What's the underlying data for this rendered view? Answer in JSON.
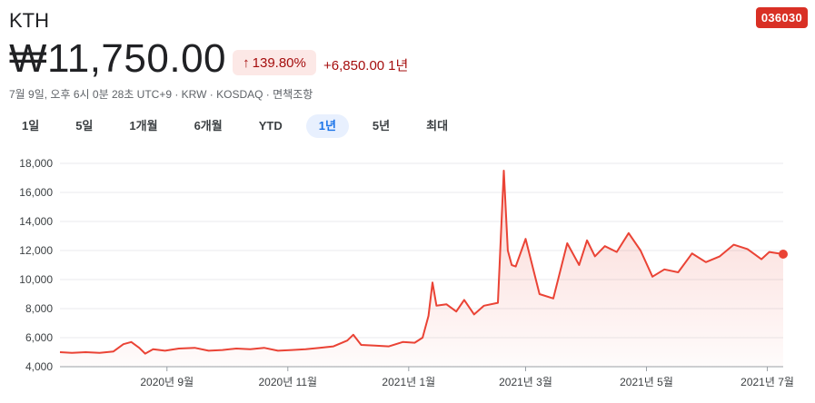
{
  "header": {
    "name": "KTH",
    "ticker": "036030",
    "price": "₩11,750.00",
    "change_pct": "139.80%",
    "change_abs": "+6,850.00",
    "period": "1년",
    "meta": "7월 9일, 오후 6시 0분 28초 UTC+9 · KRW · KOSDAQ · 면책조항"
  },
  "tabs": [
    {
      "label": "1일"
    },
    {
      "label": "5일"
    },
    {
      "label": "1개월"
    },
    {
      "label": "6개월"
    },
    {
      "label": "YTD"
    },
    {
      "label": "1년",
      "active": true
    },
    {
      "label": "5년"
    },
    {
      "label": "최대"
    }
  ],
  "colors": {
    "line": "#ea4335",
    "badge": "#d93025",
    "positive_text": "#a50e0e",
    "active_tab": "#1a73e8"
  },
  "chart_data": {
    "type": "area",
    "ylim": [
      4000,
      18000
    ],
    "y_ticks": [
      4000,
      6000,
      8000,
      10000,
      12000,
      14000,
      16000,
      18000
    ],
    "y_tick_labels": [
      "4,000",
      "6,000",
      "8,000",
      "10,000",
      "12,000",
      "14,000",
      "16,000",
      "18,000"
    ],
    "x_ticks": [
      {
        "date": "2020-09-01",
        "label": "2020년 9월"
      },
      {
        "date": "2020-11-01",
        "label": "2020년 11월"
      },
      {
        "date": "2021-01-01",
        "label": "2021년 1월"
      },
      {
        "date": "2021-03-01",
        "label": "2021년 3월"
      },
      {
        "date": "2021-05-01",
        "label": "2021년 5월"
      },
      {
        "date": "2021-07-01",
        "label": "2021년 7월"
      }
    ],
    "x": [
      "2020-07-09",
      "2020-07-15",
      "2020-07-22",
      "2020-07-29",
      "2020-08-05",
      "2020-08-10",
      "2020-08-14",
      "2020-08-18",
      "2020-08-21",
      "2020-08-25",
      "2020-08-31",
      "2020-09-07",
      "2020-09-15",
      "2020-09-22",
      "2020-09-29",
      "2020-10-06",
      "2020-10-13",
      "2020-10-20",
      "2020-10-27",
      "2020-11-03",
      "2020-11-10",
      "2020-11-17",
      "2020-11-24",
      "2020-12-01",
      "2020-12-04",
      "2020-12-08",
      "2020-12-15",
      "2020-12-22",
      "2020-12-29",
      "2021-01-04",
      "2021-01-08",
      "2021-01-11",
      "2021-01-13",
      "2021-01-15",
      "2021-01-20",
      "2021-01-25",
      "2021-01-29",
      "2021-02-03",
      "2021-02-08",
      "2021-02-15",
      "2021-02-18",
      "2021-02-20",
      "2021-02-22",
      "2021-02-24",
      "2021-03-01",
      "2021-03-08",
      "2021-03-15",
      "2021-03-22",
      "2021-03-28",
      "2021-04-01",
      "2021-04-05",
      "2021-04-10",
      "2021-04-16",
      "2021-04-22",
      "2021-04-28",
      "2021-05-04",
      "2021-05-10",
      "2021-05-17",
      "2021-05-24",
      "2021-05-31",
      "2021-06-07",
      "2021-06-14",
      "2021-06-21",
      "2021-06-28",
      "2021-07-02",
      "2021-07-09"
    ],
    "values": [
      5000,
      4950,
      5000,
      4950,
      5050,
      5550,
      5700,
      5300,
      4900,
      5200,
      5100,
      5250,
      5300,
      5100,
      5150,
      5250,
      5200,
      5300,
      5100,
      5150,
      5200,
      5300,
      5400,
      5800,
      6200,
      5500,
      5450,
      5400,
      5700,
      5650,
      6000,
      7500,
      9800,
      8200,
      8300,
      7800,
      8600,
      7600,
      8200,
      8400,
      17500,
      12000,
      11000,
      10900,
      12800,
      9000,
      8700,
      12500,
      11000,
      12700,
      11600,
      12300,
      11900,
      13200,
      12000,
      10200,
      10700,
      10500,
      11800,
      11200,
      11600,
      12400,
      12100,
      11400,
      11900,
      11750
    ],
    "last_value": 11750
  }
}
